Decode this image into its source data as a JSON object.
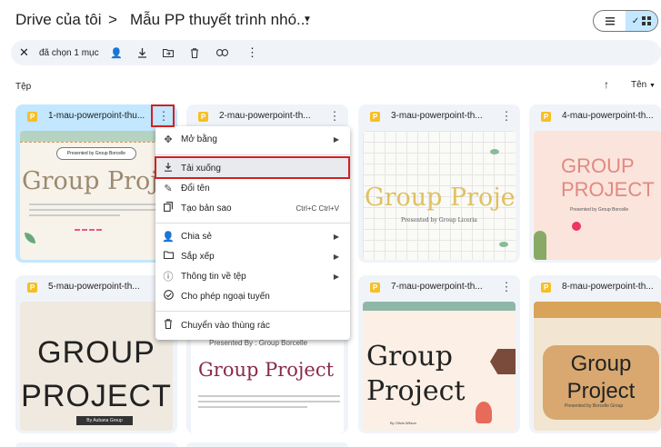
{
  "header": {
    "root_crumb": "Drive của tôi",
    "separator": ">",
    "folder_crumb": "Mẫu PP thuyết trình nhó...",
    "list_view_icon": "list-icon",
    "grid_view_icon": "grid-icon"
  },
  "action_bar": {
    "selection_text": "đã chọn 1 mục"
  },
  "section": {
    "label": "Tệp",
    "sort_label": "Tên"
  },
  "files": [
    {
      "name": "1-mau-powerpoint-thu...",
      "thumb_title": "Group Projec",
      "thumb_sub": "Presented by Group Borcelle",
      "selected": true
    },
    {
      "name": "2-mau-powerpoint-th...",
      "thumb_title": "",
      "thumb_sub": ""
    },
    {
      "name": "3-mau-powerpoint-th...",
      "thumb_title": "Group Projec",
      "thumb_sub": "Presented by Group Liceria"
    },
    {
      "name": "4-mau-powerpoint-th...",
      "thumb_title": "GROUP PROJECT",
      "thumb_sub": "Presented by Group Borcelle"
    },
    {
      "name": "5-mau-powerpoint-th...",
      "thumb_title": "GROUP PROJECT",
      "thumb_sub": "By Aubana Group"
    },
    {
      "name": "",
      "thumb_title": "Group Project",
      "thumb_sub": "Presented By : Group Borcelle"
    },
    {
      "name": "7-mau-powerpoint-th...",
      "thumb_title": "Group Project",
      "thumb_sub": "By Olivia Wilson"
    },
    {
      "name": "8-mau-powerpoint-th...",
      "thumb_title": "Group Project",
      "thumb_sub": "Presented by Borcelle Group"
    }
  ],
  "context_menu": {
    "open_with": "Mở bằng",
    "download": "Tải xuống",
    "rename": "Đổi tên",
    "make_copy": "Tạo bản sao",
    "make_copy_shortcut": "Ctrl+C Ctrl+V",
    "share": "Chia sẻ",
    "organize": "Sắp xếp",
    "file_info": "Thông tin về tệp",
    "offline": "Cho phép ngoại tuyến",
    "trash": "Chuyển vào thùng rác"
  },
  "colors": {
    "highlight": "#d32020",
    "selected_card": "#c2e7ff",
    "slides_icon": "#f6bf26"
  }
}
